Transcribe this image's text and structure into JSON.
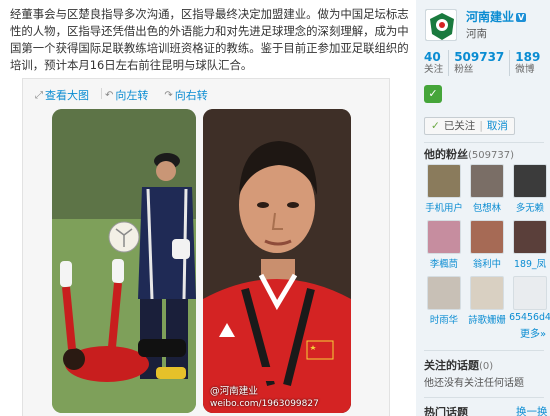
{
  "post": {
    "text": "经董事会与区楚良指导多次沟通，区指导最终决定加盟建业。做为中国足坛标志性的人物，区指导还凭借出色的外语能力和对先进足球理念的深刻理解，成为中国第一个获得国际足联教练培训班资格证的教练。鉴于目前正参加亚足联组织的培训，预计本月16日左右前往昆明与球队汇合。"
  },
  "media": {
    "tools": [
      {
        "icon": "zoom-in-icon",
        "label": "查看大图"
      },
      {
        "icon": "rotate-left-icon",
        "label": "向左转"
      },
      {
        "icon": "rotate-right-icon",
        "label": "向右转"
      }
    ],
    "watermark_line1": "@河南建业",
    "watermark_line2": "weibo.com/1963099827"
  },
  "profile": {
    "name": "河南建业",
    "verified_mark": "V",
    "location": "河南",
    "stats": [
      {
        "num": "40",
        "label": "关注"
      },
      {
        "num": "509737",
        "label": "粉丝"
      },
      {
        "num": "189",
        "label": "微博"
      }
    ],
    "follow_status": "已关注",
    "cancel_label": "取消"
  },
  "fans": {
    "title": "他的粉丝",
    "count": "(509737)",
    "items": [
      {
        "name": "手机用户",
        "color": "#8a7b5c"
      },
      {
        "name": "包想林",
        "color": "#7a6e66"
      },
      {
        "name": "多无赖",
        "color": "#3b3b3b"
      },
      {
        "name": "李楓茼",
        "color": "#c68d9f"
      },
      {
        "name": "翁利中",
        "color": "#a66a55"
      },
      {
        "name": "189_凤",
        "color": "#5a3f3a"
      },
      {
        "name": "时雨华",
        "color": "#c8c0b6"
      },
      {
        "name": "詩歌姗姗",
        "color": "#d9d0c2"
      },
      {
        "name": "65456d4",
        "color": "#e9ecef"
      }
    ],
    "more": "更多»"
  },
  "topics": {
    "title": "关注的话题",
    "count": "(0)",
    "empty": "他还没有关注任何话题"
  },
  "hot": {
    "title": "热门话题",
    "refresh": "换一换"
  },
  "colors": {
    "link": "#0a8cd2",
    "sidebar_bg": "#eef3f7",
    "verified_bg": "#1c8fd6"
  }
}
